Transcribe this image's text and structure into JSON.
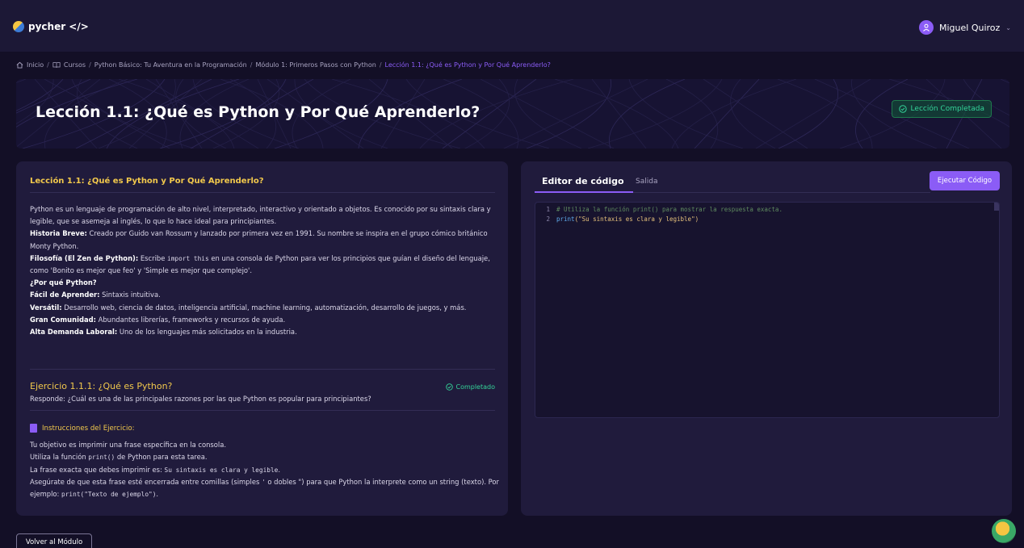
{
  "app": {
    "name": "pycher </>"
  },
  "user": {
    "name": "Miguel Quiroz"
  },
  "breadcrumb": {
    "home": "Inicio",
    "courses": "Cursos",
    "course": "Python Básico: Tu Aventura en la Programación",
    "module": "Módulo 1: Primeros Pasos con Python",
    "lesson": "Lección 1.1: ¿Qué es Python y Por Qué Aprenderlo?",
    "separator": "/"
  },
  "hero": {
    "title": "Lección 1.1: ¿Qué es Python y Por Qué Aprenderlo?",
    "status": "Lección Completada"
  },
  "lesson": {
    "title": "Lección 1.1: ¿Qué es Python y Por Qué Aprenderlo?",
    "intro": "Python es un lenguaje de programación de alto nivel, interpretado, interactivo y orientado a objetos. Es conocido por su sintaxis clara y legible, que se asemeja al inglés, lo que lo hace ideal para principiantes.",
    "history_label": "Historia Breve:",
    "history": " Creado por Guido van Rossum y lanzado por primera vez en 1991. Su nombre se inspira en el grupo cómico británico Monty Python.",
    "philosophy_label": "Filosofía (El Zen de Python):",
    "philosophy_pre": " Escribe ",
    "philosophy_code": "import this",
    "philosophy_post": " en una consola de Python para ver los principios que guían el diseño del lenguaje, como 'Bonito es mejor que feo' y 'Simple es mejor que complejo'.",
    "why_label": "¿Por qué Python?",
    "easy_label": "Fácil de Aprender:",
    "easy": " Sintaxis intuitiva.",
    "versatile_label": "Versátil:",
    "versatile": " Desarrollo web, ciencia de datos, inteligencia artificial, machine learning, automatización, desarrollo de juegos, y más.",
    "community_label": "Gran Comunidad:",
    "community": " Abundantes librerías, frameworks y recursos de ayuda.",
    "demand_label": "Alta Demanda Laboral:",
    "demand": " Uno de los lenguajes más solicitados en la industria."
  },
  "exercise": {
    "title": "Ejercicio 1.1.1: ¿Qué es Python?",
    "status": "Completado",
    "question": "Responde: ¿Cuál es una de las principales razones por las que Python es popular para principiantes?",
    "instructions_title": "Instrucciones del Ejercicio:",
    "line1": "Tu objetivo es imprimir una frase específica en la consola.",
    "line2_pre": "Utiliza la función ",
    "line2_code": "print()",
    "line2_post": " de Python para esta tarea.",
    "line3_pre": "La frase exacta que debes imprimir es: ",
    "line3_code": "Su sintaxis es clara y legible",
    "line3_post": ".",
    "line4_pre": "Asegúrate de que esta frase esté encerrada entre comillas (simples ",
    "line4_q1": "'",
    "line4_mid": " o dobles \") para que Python la interprete como un string (texto). Por ejemplo: ",
    "line4_code": "print(\"Texto de ejemplo\")",
    "line4_post": "."
  },
  "editor": {
    "tab_code": "Editor de código",
    "tab_output": "Salida",
    "run_label": "Ejecutar Código",
    "lines": [
      {
        "num": "1",
        "text": "# Utiliza la función print() para mostrar la respuesta exacta."
      },
      {
        "num": "2",
        "fn": "print",
        "args": "(\"Su sintaxis es clara y legible\")"
      }
    ]
  },
  "footer": {
    "back_label": "Volver al Módulo"
  },
  "colors": {
    "accent": "#8b5cf6",
    "heading": "#f2c94c",
    "success": "#34d399",
    "background": "#130f26",
    "panel": "#201b3c"
  }
}
